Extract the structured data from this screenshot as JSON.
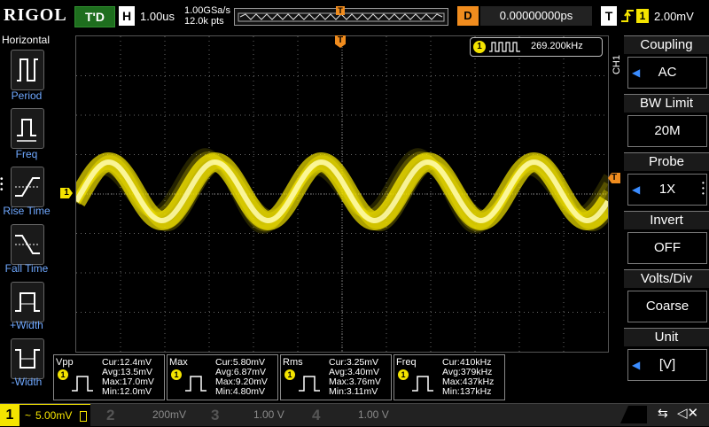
{
  "header": {
    "brand": "RIGOL",
    "run_status": "T'D",
    "timebase_tag": "H",
    "timebase": "1.00us",
    "sample_rate": "1.00GSa/s",
    "memory_depth": "12.0k pts",
    "delay_tag": "D",
    "delay": "0.00000000ps",
    "trigger_tag": "T",
    "trigger_level": "2.00mV",
    "trigger_marker": "T"
  },
  "left_menu": {
    "title": "Horizontal",
    "items": [
      {
        "label": "Period"
      },
      {
        "label": "Freq"
      },
      {
        "label": "Rise Time"
      },
      {
        "label": "Fall Time"
      },
      {
        "label": "+Width"
      },
      {
        "label": "-Width"
      }
    ]
  },
  "screen": {
    "channel_marker": "1",
    "trigger_level_marker": "T",
    "counter_channel": "1",
    "counter_value": "269.200kHz"
  },
  "right_menu": {
    "channel_tag": "CH1",
    "items": [
      {
        "title": "Coupling",
        "value": "AC"
      },
      {
        "title": "BW Limit",
        "value": "20M"
      },
      {
        "title": "Probe",
        "value": "1X"
      },
      {
        "title": "Invert",
        "value": "OFF"
      },
      {
        "title": "Volts/Div",
        "value": "Coarse"
      },
      {
        "title": "Unit",
        "value": "[V]"
      }
    ]
  },
  "measurements": [
    {
      "name": "Vpp",
      "ch": "1",
      "cur": "Cur:12.4mV",
      "avg": "Avg:13.5mV",
      "max": "Max:17.0mV",
      "min": "Min:12.0mV"
    },
    {
      "name": "Max",
      "ch": "1",
      "cur": "Cur:5.80mV",
      "avg": "Avg:6.87mV",
      "max": "Max:9.20mV",
      "min": "Min:4.80mV"
    },
    {
      "name": "Rms",
      "ch": "1",
      "cur": "Cur:3.25mV",
      "avg": "Avg:3.40mV",
      "max": "Max:3.76mV",
      "min": "Min:3.11mV"
    },
    {
      "name": "Freq",
      "ch": "1",
      "cur": "Cur:410kHz",
      "avg": "Avg:379kHz",
      "max": "Max:437kHz",
      "min": "Min:137kHz"
    }
  ],
  "channels": [
    {
      "num": "1",
      "scale": "5.00mV"
    },
    {
      "num": "2",
      "scale": "200mV"
    },
    {
      "num": "3",
      "scale": "1.00 V"
    },
    {
      "num": "4",
      "scale": "1.00 V"
    }
  ],
  "colors": {
    "ch1": "#f4e400",
    "trigger": "#f08c1e",
    "menu_accent": "#3a8cff"
  }
}
